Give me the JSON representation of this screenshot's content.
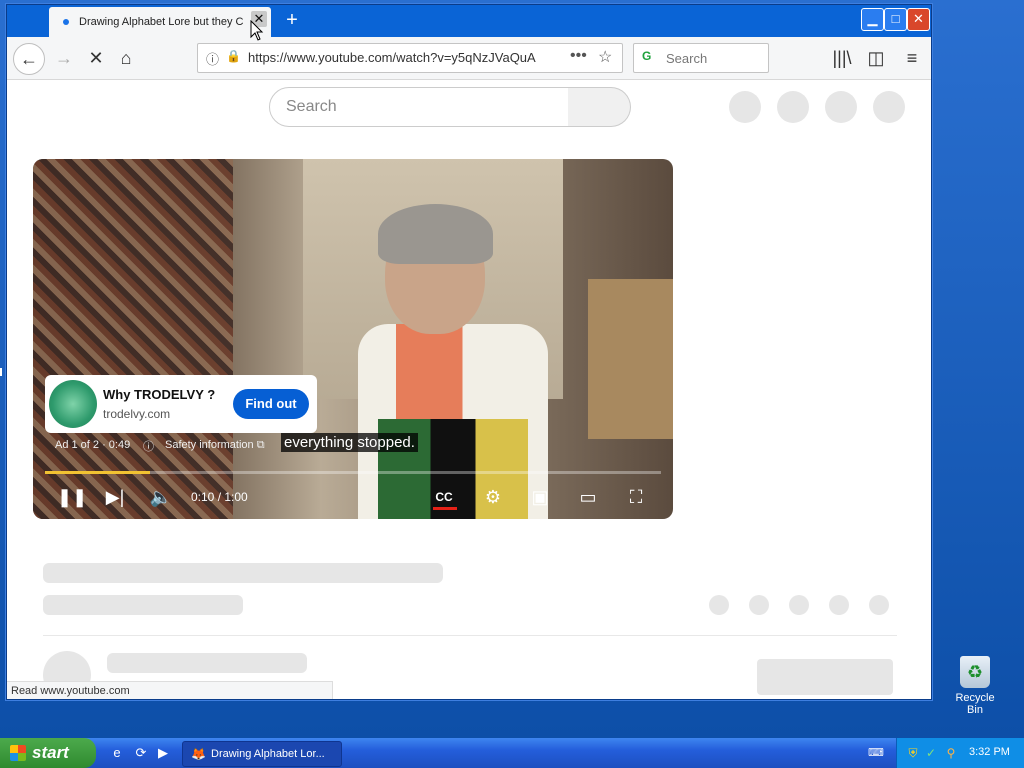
{
  "browser": {
    "tab_title": "Drawing Alphabet Lore but they C",
    "tab_close": "✕",
    "new_tab": "+",
    "window_controls": {
      "minimize": "▁",
      "maximize": "□",
      "close": "✕"
    },
    "url": "https://www.youtube.com/watch?v=y5qNzJVaQuA",
    "search_placeholder": "Search",
    "status_text": "Read www.youtube.com"
  },
  "nav_icons": {
    "back": "←",
    "forward": "→",
    "stop": "✕",
    "home": "⌂",
    "info": "ⓘ",
    "lock": "🔒",
    "more": "•••",
    "star": "☆",
    "library": "|||\\",
    "sidebar": "◫",
    "menu": "≡",
    "search_engine": "G"
  },
  "youtube": {
    "search_placeholder": "Search",
    "ad": {
      "title": "Why TRODELVY ?",
      "domain": "trodelvy.com",
      "cta": "Find out",
      "info": "Ad 1 of 2 · 0:49",
      "info_icon": "ⓘ",
      "safety": "Safety information ⧉"
    },
    "caption": "everything stopped.",
    "player": {
      "progress": 0.17,
      "time": "0:10 / 1:00",
      "pause_icon": "❚❚",
      "next_icon": "▶|",
      "volume_icon": "🔈",
      "cc_icon": "CC",
      "settings_icon": "⚙",
      "miniplayer_icon": "▣",
      "theater_icon": "▭",
      "fullscreen_icon": "⛶"
    }
  },
  "desktop": {
    "recycle_bin_label": "Recycle Bin",
    "recycle_glyph": "♻"
  },
  "taskbar": {
    "start_label": "start",
    "quicklaunch": [
      "e",
      "⟳",
      "▶"
    ],
    "task_icon": "🦊",
    "task_label": "Drawing Alphabet Lor...",
    "keyboard_icon": "⌨",
    "tray_icons": [
      "⛨",
      "✓",
      "⚲"
    ],
    "clock": "3:32 PM"
  },
  "colors": {
    "accent_blue": "#065fd4",
    "progress": "#f1c232",
    "xp_blue": "#245edb",
    "start_green": "#2f8a2f"
  }
}
